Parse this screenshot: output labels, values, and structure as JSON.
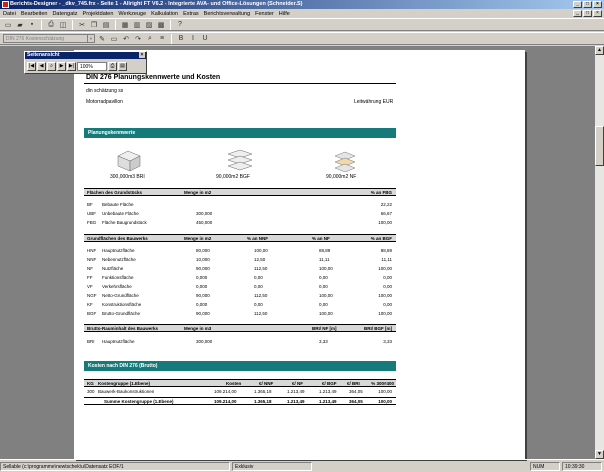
{
  "window": {
    "title": "Berichts-Designer - _dkv_745.frx - Seite 1 - Allright FT V6.2 - Integrierte AVA- und Office-Lösungen (Schneider.S)"
  },
  "menu": [
    "Datei",
    "Bearbeiten",
    "Datengatz",
    "Projektdaten",
    "Werkzeuge",
    "Kalkulation",
    "Extras",
    "Berichtsverwaltung",
    "Fenster",
    "Hilfe"
  ],
  "toolbar": {
    "combo_value": "DIN 276 Kostenschätzung"
  },
  "floater": {
    "title": "Seitenansicht",
    "zoom": "100%"
  },
  "report": {
    "title": "DIN 276 Planungskennwerte und Kosten",
    "subtitle": "din schätzung ss",
    "project": "Motorradpavillon",
    "currency": "Leitwährung EUR",
    "section1": "Planungskennwerte",
    "icons": [
      {
        "label": "300,000m3 BRI"
      },
      {
        "label": "90,000m2 BGF"
      },
      {
        "label": "90,000m2 NF"
      }
    ],
    "t1": {
      "head": [
        "Flächen des Grundstücks",
        "Menge in m2",
        "% an FBG"
      ],
      "rows": [
        [
          "BF",
          "Bebaute Fläche",
          "",
          "22,22"
        ],
        [
          "UBF",
          "Unbebaute Fläche",
          "300,000",
          "66,67"
        ],
        [
          "FBG",
          "Fläche Baugrundstück",
          "450,000",
          "100,00"
        ]
      ]
    },
    "t2": {
      "head": [
        "Grundflächen des Bauwerks",
        "Menge in m2",
        "% an NNF",
        "% an NF",
        "% an BGF"
      ],
      "rows": [
        [
          "HNF",
          "Hauptnutzfläche",
          "80,000",
          "100,00",
          "88,89",
          "88,89"
        ],
        [
          "NNF",
          "Nebennutzfläche",
          "10,000",
          "12,50",
          "11,11",
          "11,11"
        ],
        [
          "NF",
          "Nutzfläche",
          "90,000",
          "112,50",
          "100,00",
          "100,00"
        ],
        [
          "FF",
          "Funktionsfläche",
          "0,000",
          "0,00",
          "0,00",
          "0,00"
        ],
        [
          "VF",
          "Verkehrsfläche",
          "0,000",
          "0,00",
          "0,00",
          "0,00"
        ],
        [
          "NGF",
          "Netto-Grundfläche",
          "90,000",
          "112,50",
          "100,00",
          "100,00"
        ],
        [
          "KF",
          "Konstruktionsfläche",
          "0,000",
          "0,00",
          "0,00",
          "0,00"
        ],
        [
          "BGF",
          "Brutto-Grundfläche",
          "90,000",
          "112,50",
          "100,00",
          "100,00"
        ]
      ]
    },
    "t3": {
      "head": [
        "Brutto-Rauminhalt des Bauwerks",
        "Menge in m3",
        "BRI/ NF [m]",
        "BRI/ BGF [m]"
      ],
      "rows": [
        [
          "BRI",
          "Hauptnutzfläche",
          "300,000",
          "3,33",
          "3,33"
        ]
      ]
    },
    "section2": "Kosten nach DIN 276 (Brutto)",
    "t4": {
      "head": [
        "KG",
        "Kostengruppe (1.Ebene)",
        "Kosten",
        "€/ NNF",
        "€/ NF",
        "€/ BGF",
        "€/ BRI",
        "% 300#400"
      ],
      "rows": [
        [
          "300",
          "Bauwerk-Baukonstruktionen",
          "109.214,00",
          "1.365,18",
          "1.213,49",
          "1.213,49",
          "364,05",
          "100,00"
        ]
      ],
      "sum": [
        "Summe Kostengruppe (1.Ebene)",
        "109.214,00",
        "1.365,18",
        "1.213,49",
        "1.213,49",
        "364,05",
        "100,00"
      ]
    }
  },
  "status": {
    "path": "Sellable (c:\\programme\\newtschek\\u\\Datensatz EOF/1",
    "mode": "Exklusiv",
    "num": "NUM",
    "time": "10:39:30"
  }
}
